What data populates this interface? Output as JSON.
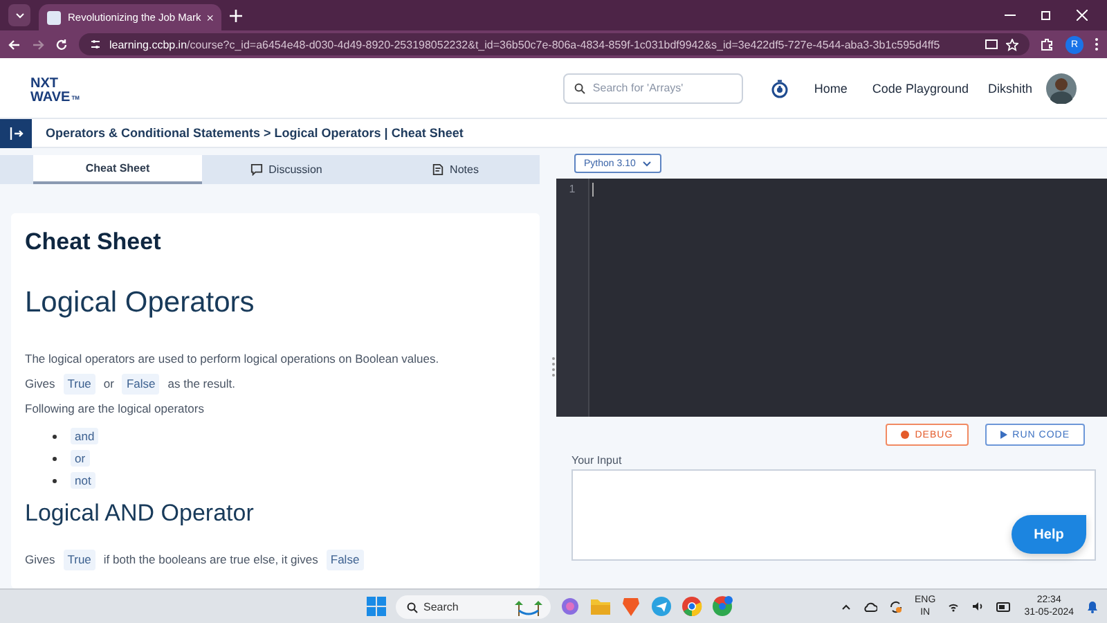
{
  "browser": {
    "tab_title": "Revolutionizing the Job Mark",
    "url_host": "learning.ccbp.in",
    "url_path": "/course?c_id=a6454e48-d030-4d49-8920-253198052232&t_id=36b50c7e-806a-4834-859f-1c031bdf9942&s_id=3e422df5-727e-4544-aba3-3b1c595d4ff5",
    "profile_initial": "R"
  },
  "header": {
    "logo_top": "NXT",
    "logo_bottom": "WAVE",
    "logo_tm": "TM",
    "search": {
      "placeholder": "Search for 'Arrays'"
    },
    "nav": [
      "Home",
      "Code Playground"
    ],
    "user": "Dikshith"
  },
  "breadcrumb": "Operators & Conditional Statements > Logical Operators | Cheat Sheet",
  "tabs": [
    {
      "label": "Cheat Sheet",
      "kind": "plain",
      "selected": true
    },
    {
      "label": "Discussion",
      "kind": "discussion",
      "selected": false
    },
    {
      "label": "Notes",
      "kind": "notes",
      "selected": false
    }
  ],
  "content": [
    {
      "kind": "h1",
      "text": "Cheat Sheet"
    },
    {
      "kind": "h2",
      "text": "Logical Operators"
    },
    {
      "kind": "para",
      "segments": [
        {
          "kind": "text",
          "text": "The logical operators are used to perform logical operations on Boolean values."
        }
      ]
    },
    {
      "kind": "para",
      "segments": [
        {
          "kind": "text",
          "text": "Gives"
        },
        {
          "kind": "code",
          "text": "True"
        },
        {
          "kind": "text",
          "text": "or"
        },
        {
          "kind": "code",
          "text": "False"
        },
        {
          "kind": "text",
          "text": "as the result."
        }
      ]
    },
    {
      "kind": "para",
      "segments": [
        {
          "kind": "text",
          "text": "Following are the logical operators"
        }
      ]
    },
    {
      "kind": "list",
      "items": [
        "and",
        "or",
        "not"
      ]
    },
    {
      "kind": "h3",
      "text": "Logical AND Operator"
    },
    {
      "kind": "para",
      "segments": [
        {
          "kind": "text",
          "text": "Gives"
        },
        {
          "kind": "code",
          "text": "True"
        },
        {
          "kind": "text",
          "text": "if both the booleans are true else, it gives"
        },
        {
          "kind": "code",
          "text": "False"
        }
      ]
    }
  ],
  "editor": {
    "language": "Python 3.10",
    "line_numbers": [
      "1"
    ],
    "debug": "DEBUG",
    "run": "RUN CODE",
    "input_label": "Your Input",
    "help": "Help"
  },
  "taskbar": {
    "search": {
      "placeholder": "Search"
    },
    "lang_top": "ENG",
    "lang_bottom": "IN",
    "time": "22:34",
    "date": "31-05-2024"
  }
}
